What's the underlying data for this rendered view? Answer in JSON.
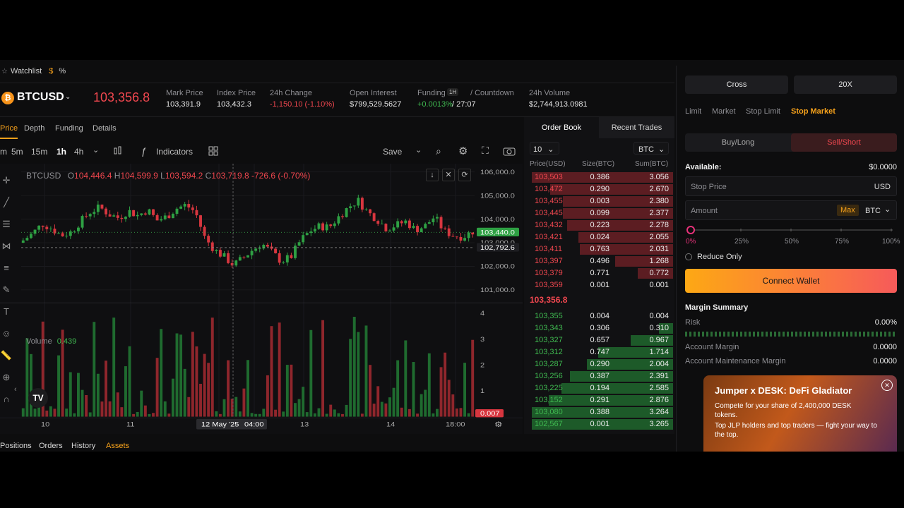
{
  "watchlist": {
    "label": "Watchlist",
    "dollar": "$",
    "percent": "%"
  },
  "ticker": {
    "symbol": "BTCUSD",
    "last_price": "103,356.8",
    "stats": [
      {
        "label": "Mark Price",
        "value": "103,391.9",
        "tone": "neutral"
      },
      {
        "label": "Index Price",
        "value": "103,432.3",
        "tone": "neutral"
      },
      {
        "label": "24h Change",
        "value": "-1,150.10 (-1.10%)",
        "tone": "red"
      },
      {
        "label": "Open Interest",
        "value": "$799,529.5627",
        "tone": "neutral"
      }
    ],
    "funding_label": "Funding",
    "funding_interval": "1H",
    "countdown_label": "/ Countdown",
    "funding_rate": "+0.0013%",
    "countdown": "/ 27:07",
    "volume_label": "24h Volume",
    "volume_value": "$2,744,913.0981"
  },
  "chart_tabs": [
    "Price",
    "Depth",
    "Funding",
    "Details"
  ],
  "toolbar": {
    "intervals": [
      "m",
      "5m",
      "15m",
      "1h",
      "4h"
    ],
    "active_interval": "1h",
    "indicators": "Indicators",
    "save": "Save"
  },
  "legend": {
    "symbol": "BTCUSD",
    "o_label": "O",
    "o": "104,446.4",
    "h_label": "H",
    "h": "104,599.9",
    "l_label": "L",
    "l": "103,594.2",
    "c_label": "C",
    "c": "103,719.8",
    "change": "-726.6 (-0.70%)",
    "volume_label": "Volume",
    "volume_value": "0.439"
  },
  "chart_data": {
    "type": "candlestick",
    "y_ticks": [
      "106,000.0",
      "105,000.0",
      "104,000.0",
      "103,000.0",
      "102,000.0",
      "101,000.0"
    ],
    "ylim": [
      100500,
      106300
    ],
    "x_ticks": [
      "10",
      "11",
      "12 May '25",
      "04:00",
      "13",
      "14",
      "18:00"
    ],
    "price_badges": {
      "last": "103,440.0",
      "crosshair": "102,792.6"
    },
    "volume_ticks": [
      "4",
      "3",
      "2",
      "1"
    ],
    "volume_ylim": [
      0,
      4
    ],
    "volume_badge": "0.007"
  },
  "orderbook": {
    "tabs": [
      "Order Book",
      "Recent Trades"
    ],
    "size_select": "10",
    "unit_select": "BTC",
    "headers": [
      "Price(USD)",
      "Size(BTC)",
      "Sum(BTC)"
    ],
    "mid_price": "103,356.8",
    "asks": [
      {
        "price": "103,503",
        "size": "0.386",
        "sum": "3.056",
        "depth": 1.0
      },
      {
        "price": "103,472",
        "size": "0.290",
        "sum": "2.670",
        "depth": 0.87
      },
      {
        "price": "103,455",
        "size": "0.003",
        "sum": "2.380",
        "depth": 0.78
      },
      {
        "price": "103,445",
        "size": "0.099",
        "sum": "2.377",
        "depth": 0.78
      },
      {
        "price": "103,432",
        "size": "0.223",
        "sum": "2.278",
        "depth": 0.75
      },
      {
        "price": "103,421",
        "size": "0.024",
        "sum": "2.055",
        "depth": 0.67
      },
      {
        "price": "103,411",
        "size": "0.763",
        "sum": "2.031",
        "depth": 0.66
      },
      {
        "price": "103,397",
        "size": "0.496",
        "sum": "1.268",
        "depth": 0.41
      },
      {
        "price": "103,379",
        "size": "0.771",
        "sum": "0.772",
        "depth": 0.25
      },
      {
        "price": "103,359",
        "size": "0.001",
        "sum": "0.001",
        "depth": 0.0
      }
    ],
    "bids": [
      {
        "price": "103,355",
        "size": "0.004",
        "sum": "0.004",
        "depth": 0.0
      },
      {
        "price": "103,343",
        "size": "0.306",
        "sum": "0.310",
        "depth": 0.1
      },
      {
        "price": "103,327",
        "size": "0.657",
        "sum": "0.967",
        "depth": 0.3
      },
      {
        "price": "103,312",
        "size": "0.747",
        "sum": "1.714",
        "depth": 0.53
      },
      {
        "price": "103,287",
        "size": "0.290",
        "sum": "2.004",
        "depth": 0.61
      },
      {
        "price": "103,256",
        "size": "0.387",
        "sum": "2.391",
        "depth": 0.73
      },
      {
        "price": "103,225",
        "size": "0.194",
        "sum": "2.585",
        "depth": 0.79
      },
      {
        "price": "103,152",
        "size": "0.291",
        "sum": "2.876",
        "depth": 0.88
      },
      {
        "price": "103,080",
        "size": "0.388",
        "sum": "3.264",
        "depth": 1.0
      },
      {
        "price": "102,567",
        "size": "0.001",
        "sum": "3.265",
        "depth": 1.0
      }
    ]
  },
  "order_panel": {
    "margin_mode": "Cross",
    "leverage": "20X",
    "order_types": [
      "Limit",
      "Market",
      "Stop Limit",
      "Stop Market"
    ],
    "active_order_type": "Stop Market",
    "buy_label": "Buy/Long",
    "sell_label": "Sell/Short",
    "available_label": "Available:",
    "available_value": "$0.0000",
    "stop_price_placeholder": "Stop Price",
    "stop_price_unit": "USD",
    "amount_placeholder": "Amount",
    "max_label": "Max",
    "amount_unit": "BTC",
    "slider_labels": [
      "0%",
      "25%",
      "50%",
      "75%",
      "100%"
    ],
    "slider_value": 0,
    "reduce_only": "Reduce Only",
    "connect_wallet": "Connect Wallet",
    "margin_summary": "Margin Summary",
    "risk_label": "Risk",
    "risk_value": "0.00%",
    "account_margin_label": "Account Margin",
    "account_margin_value": "0.0000",
    "maintenance_label": "Account Maintenance Margin",
    "maintenance_value": "0.0000"
  },
  "promo": {
    "title": "Jumper x DESK: DeFi Gladiator",
    "body": "Compete for your share of 2,400,000 DESK tokens.",
    "body2": "Top JLP holders and top traders — fight your way to the top."
  },
  "bottom_tabs": [
    "Positions",
    "Orders",
    "History",
    "Assets"
  ],
  "colors": {
    "accent": "#f7a21b",
    "red": "#f0474f",
    "green": "#3fb950"
  }
}
